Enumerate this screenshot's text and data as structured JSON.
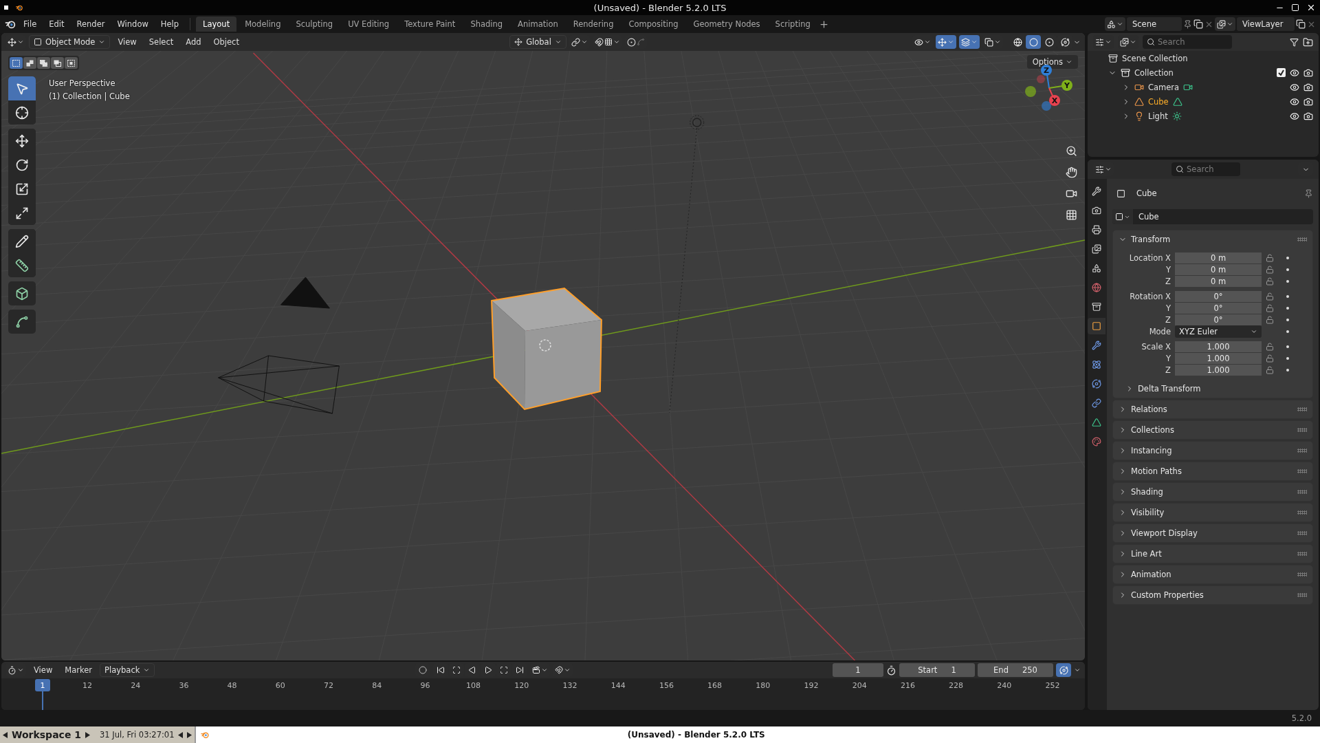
{
  "os_title": "(Unsaved) - Blender 5.2.0 LTS",
  "menu": [
    "File",
    "Edit",
    "Render",
    "Window",
    "Help"
  ],
  "workspaces": [
    {
      "label": "Layout",
      "selected": true
    },
    {
      "label": "Modeling",
      "selected": false
    },
    {
      "label": "Sculpting",
      "selected": false
    },
    {
      "label": "UV Editing",
      "selected": false
    },
    {
      "label": "Texture Paint",
      "selected": false
    },
    {
      "label": "Shading",
      "selected": false
    },
    {
      "label": "Animation",
      "selected": false
    },
    {
      "label": "Rendering",
      "selected": false
    },
    {
      "label": "Compositing",
      "selected": false
    },
    {
      "label": "Geometry Nodes",
      "selected": false
    },
    {
      "label": "Scripting",
      "selected": false
    }
  ],
  "scene": "Scene",
  "view_layer": "ViewLayer",
  "viewport_header": {
    "mode": "Object Mode",
    "menus": [
      "View",
      "Select",
      "Add",
      "Object"
    ],
    "orientation": "Global",
    "toggles": [
      {
        "kind": "visibility",
        "on": false
      },
      {
        "kind": "gizmo",
        "on": true
      },
      {
        "kind": "overlay",
        "on": true
      },
      {
        "kind": "xray",
        "on": false
      }
    ],
    "shading": [
      {
        "kind": "wireframe",
        "selected": false
      },
      {
        "kind": "solid",
        "selected": true
      },
      {
        "kind": "material",
        "selected": false
      },
      {
        "kind": "rendered",
        "selected": false
      }
    ]
  },
  "select_modes": [
    {
      "kind": "set",
      "selected": true
    },
    {
      "kind": "extend",
      "selected": false
    },
    {
      "kind": "subtract",
      "selected": false
    },
    {
      "kind": "invert",
      "selected": false
    },
    {
      "kind": "intersect",
      "selected": false
    }
  ],
  "tool_groups": [
    [
      {
        "kind": "select",
        "selected": true
      },
      {
        "kind": "cursor",
        "selected": false
      }
    ],
    [
      {
        "kind": "move",
        "selected": false
      },
      {
        "kind": "rotate",
        "selected": false
      },
      {
        "kind": "scale",
        "selected": false
      },
      {
        "kind": "transform",
        "selected": false
      }
    ],
    [
      {
        "kind": "annotate",
        "selected": false
      },
      {
        "kind": "measure",
        "selected": false
      }
    ],
    [
      {
        "kind": "add_cube",
        "selected": false
      }
    ],
    [
      {
        "kind": "shear",
        "selected": false
      }
    ]
  ],
  "viewport": {
    "lines": [
      "User Perspective",
      "(1) Collection | Cube"
    ],
    "options": "Options",
    "gizmo": [
      {
        "label": "Z",
        "color": "#2f7fd8"
      },
      {
        "label": "Y",
        "color": "#7fb01a"
      },
      {
        "label": "X",
        "color": "#e8424f"
      }
    ]
  },
  "outliner": {
    "search": {
      "placeholder": "Search"
    },
    "root": "Scene Collection",
    "collection": {
      "label": "Collection",
      "checked": true,
      "expanded": true,
      "children": [
        {
          "label": "Camera",
          "kind": "camera",
          "selected": false
        },
        {
          "label": "Cube",
          "kind": "mesh",
          "selected": true
        },
        {
          "label": "Light",
          "kind": "light",
          "selected": false
        }
      ]
    }
  },
  "properties": {
    "search": {
      "placeholder": "Search"
    },
    "object": "Cube",
    "name_field": "Cube",
    "tabs": [
      {
        "kind": "tool",
        "selected": false
      },
      {
        "kind": "render",
        "selected": false
      },
      {
        "kind": "output",
        "selected": false
      },
      {
        "kind": "view_layer",
        "selected": false
      },
      {
        "kind": "scene",
        "selected": false
      },
      {
        "kind": "world",
        "selected": false
      },
      {
        "kind": "collection",
        "selected": false
      },
      {
        "kind": "object",
        "selected": true
      },
      {
        "kind": "modifiers",
        "selected": false
      },
      {
        "kind": "particles",
        "selected": false
      },
      {
        "kind": "physics",
        "selected": false
      },
      {
        "kind": "constraints",
        "selected": false
      },
      {
        "kind": "data",
        "selected": false
      },
      {
        "kind": "material",
        "selected": false
      }
    ],
    "transform": {
      "title": "Transform",
      "expanded": true,
      "groups": [
        [
          {
            "label": "Location X",
            "value": "0 m",
            "kind": "number"
          },
          {
            "label": "Y",
            "value": "0 m",
            "kind": "number"
          },
          {
            "label": "Z",
            "value": "0 m",
            "kind": "number"
          }
        ],
        [
          {
            "label": "Rotation X",
            "value": "0°",
            "kind": "number"
          },
          {
            "label": "Y",
            "value": "0°",
            "kind": "number"
          },
          {
            "label": "Z",
            "value": "0°",
            "kind": "number"
          },
          {
            "label": "Mode",
            "value": "XYZ Euler",
            "kind": "select"
          }
        ],
        [
          {
            "label": "Scale X",
            "value": "1.000",
            "kind": "number"
          },
          {
            "label": "Y",
            "value": "1.000",
            "kind": "number"
          },
          {
            "label": "Z",
            "value": "1.000",
            "kind": "number"
          }
        ]
      ],
      "sub": {
        "title": "Delta Transform",
        "expanded": false
      }
    },
    "panels": [
      {
        "title": "Relations",
        "expanded": false
      },
      {
        "title": "Collections",
        "expanded": false
      },
      {
        "title": "Instancing",
        "expanded": false
      },
      {
        "title": "Motion Paths",
        "expanded": false
      },
      {
        "title": "Shading",
        "expanded": false
      },
      {
        "title": "Visibility",
        "expanded": false
      },
      {
        "title": "Viewport Display",
        "expanded": false
      },
      {
        "title": "Line Art",
        "expanded": false
      },
      {
        "title": "Animation",
        "expanded": false
      },
      {
        "title": "Custom Properties",
        "expanded": false
      }
    ]
  },
  "timeline": {
    "menus": [
      "View",
      "Marker"
    ],
    "playback": "Playback",
    "current_frame": "1",
    "start_label": "Start",
    "start": "1",
    "end_label": "End",
    "end": "250",
    "playhead": "1",
    "ruler": [
      "12",
      "24",
      "36",
      "48",
      "60",
      "72",
      "84",
      "96",
      "108",
      "120",
      "132",
      "144",
      "156",
      "168",
      "180",
      "192",
      "204",
      "216",
      "228",
      "240",
      "252"
    ]
  },
  "status": {
    "version": "5.2.0"
  },
  "taskbar": {
    "workspace": "Workspace 1",
    "clock": "31 Jul, Fri 03:27:01",
    "window_title": "(Unsaved) - Blender 5.2.0 LTS"
  }
}
